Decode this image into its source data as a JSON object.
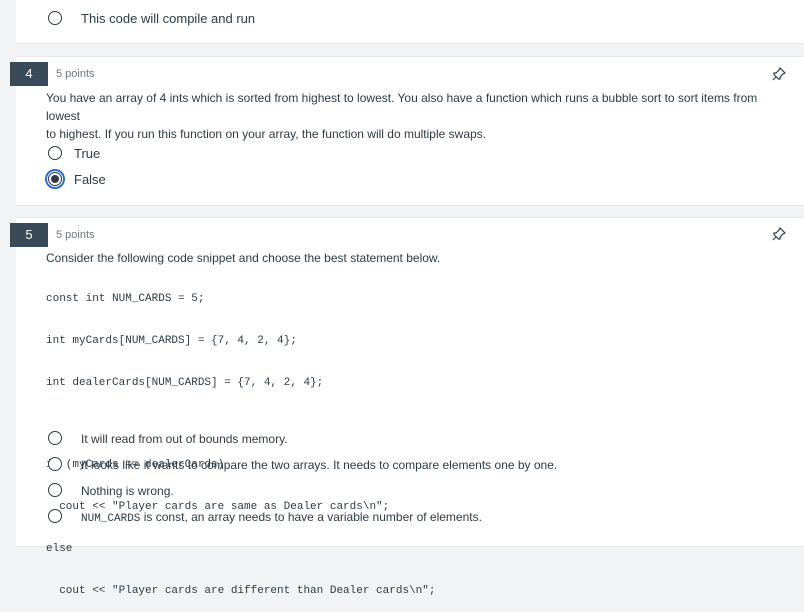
{
  "prev_question": {
    "option": "This code will compile and run"
  },
  "q4": {
    "number": "4",
    "points": "5 points",
    "text_line1": "You have an array of 4 ints which is sorted from highest to lowest.  You also have a function which runs a bubble sort to sort items from lowest",
    "text_line2": "to highest.  If you run this function on your array, the function will do multiple swaps.",
    "options": [
      "True",
      "False"
    ],
    "selected": "False"
  },
  "q5": {
    "number": "5",
    "points": "5 points",
    "prompt": "Consider the following code snippet and choose the best statement below.",
    "code": [
      "const int NUM_CARDS = 5;",
      "int myCards[NUM_CARDS] = {7, 4, 2, 4};",
      "int dealerCards[NUM_CARDS] = {7, 4, 2, 4};",
      "",
      "if (myCards == dealerCards)",
      "  cout << \"Player cards are same as Dealer cards\\n\";",
      "else",
      "  cout << \"Player cards are different than Dealer cards\\n\";"
    ],
    "options": [
      "It will read from out of bounds memory.",
      "It looks like it wants to compare the two arrays.  It needs to compare elements one by one.",
      "Nothing is wrong."
    ],
    "option4_code": "NUM_CARDS",
    "option4_rest": " is const, an array needs to have a variable number of elements."
  }
}
